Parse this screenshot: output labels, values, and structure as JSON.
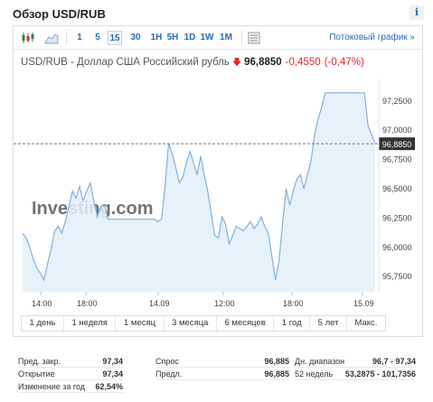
{
  "header": {
    "title": "Обзор USD/RUB",
    "info_label": "i"
  },
  "toolbar": {
    "icons": [
      "candlestick-icon",
      "area-chart-icon",
      "settings-panel-icon"
    ],
    "intervals": [
      "1",
      "5",
      "15",
      "30",
      "1H",
      "5H",
      "1D",
      "1W",
      "1M"
    ],
    "active_interval": "15",
    "streaming_link": "Потоковый график  »"
  },
  "quote": {
    "name": "USD/RUB - Доллар США Российский рубль",
    "arrow": "🡇",
    "price": "96,8850",
    "change": "-0,4550",
    "change_pct": "(-0,47%)",
    "accent_color": "#e0282c"
  },
  "chart_data": {
    "type": "area",
    "title": "",
    "xlabel": "",
    "ylabel": "",
    "x_ticks": [
      "14:00",
      "18:00",
      "14.09",
      "12:00",
      "18:00",
      "15.09"
    ],
    "y_ticks": [
      "97,2500",
      "97,0000",
      "96,7500",
      "96,5000",
      "96,2500",
      "96,0000",
      "95,7500"
    ],
    "ylim": [
      95.62,
      97.38
    ],
    "last_value": 96.885,
    "last_value_label": "96,8850",
    "watermark": "Investing.com",
    "grid": false,
    "series": [
      {
        "values": [
          96.12,
          96.08,
          96.0,
          95.9,
          95.82,
          95.78,
          95.72,
          95.86,
          95.98,
          96.14,
          96.18,
          96.12,
          96.22,
          96.35,
          96.48,
          96.42,
          96.52,
          96.4,
          96.48,
          96.55,
          96.4,
          96.26,
          96.35,
          96.36,
          96.24,
          96.24,
          96.24,
          96.24,
          96.24,
          96.24,
          96.24,
          96.24,
          96.24,
          96.24,
          96.24,
          96.24,
          96.24,
          96.24,
          96.22,
          96.24,
          96.52,
          96.89,
          96.8,
          96.68,
          96.55,
          96.6,
          96.72,
          96.82,
          96.72,
          96.62,
          96.78,
          96.62,
          96.48,
          96.28,
          96.1,
          96.08,
          96.26,
          96.2,
          96.03,
          96.1,
          96.18,
          96.16,
          96.14,
          96.18,
          96.22,
          96.16,
          96.2,
          96.26,
          96.18,
          96.12,
          95.92,
          95.72,
          95.88,
          96.2,
          96.5,
          96.36,
          96.48,
          96.58,
          96.62,
          96.5,
          96.62,
          96.74,
          96.96,
          97.1,
          97.2,
          97.32,
          97.32,
          97.32,
          97.32,
          97.32,
          97.32,
          97.32,
          97.32,
          97.32,
          97.32,
          97.32,
          97.32,
          97.04,
          96.96,
          96.89
        ]
      }
    ],
    "colors": {
      "line": "#7fb1dd",
      "fill": "#e3eef8",
      "last_value_box": "#333333"
    }
  },
  "ranges": [
    "1 день",
    "1 неделя",
    "1 месяц",
    "3 месяца",
    "6 месяцев",
    "1 год",
    "5 лет",
    "Макс."
  ],
  "stats": [
    {
      "label": "Пред. закр.",
      "value": "97,34"
    },
    {
      "label": "Открытие",
      "value": "97,34"
    },
    {
      "label": "Изменение за год",
      "value": "62,54%"
    },
    {
      "label": "Спрос",
      "value": "96,885"
    },
    {
      "label": "Предл.",
      "value": "96,885"
    },
    {
      "label": "Дн. диапазон",
      "value": "96,7 - 97,34"
    },
    {
      "label": "52 недель",
      "value": "53,2875 - 101,7356"
    }
  ]
}
